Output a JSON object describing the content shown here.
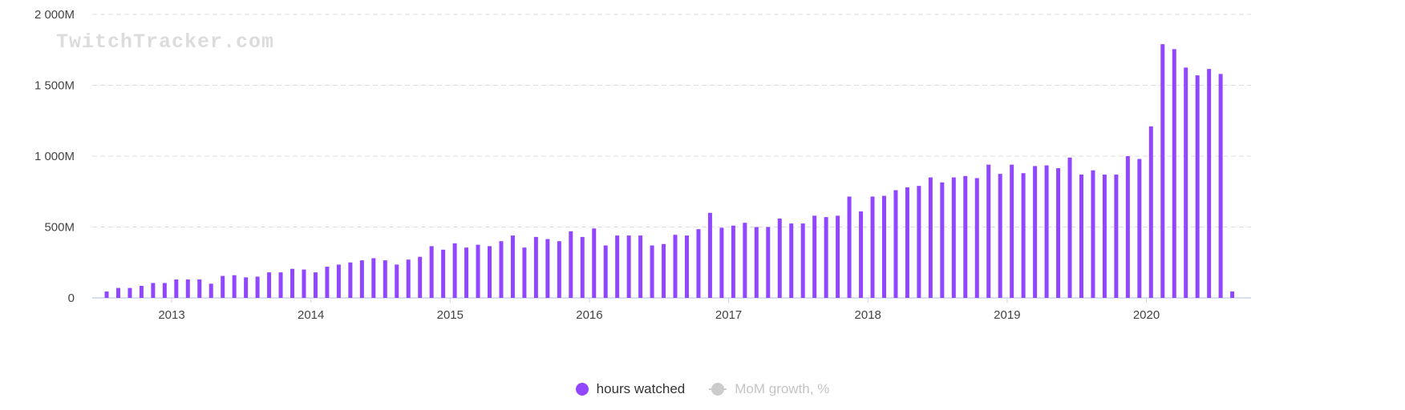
{
  "watermark": "TwitchTracker.com",
  "legend": {
    "hours_watched": "hours watched",
    "mom_growth": "MoM growth, %"
  },
  "colors": {
    "bar": "#9147ff",
    "inactive": "#cccccc"
  },
  "chart_data": {
    "type": "bar",
    "title": "",
    "xlabel": "",
    "ylabel": "",
    "ylim": [
      0,
      2000
    ],
    "y_unit": "M",
    "y_ticks": [
      {
        "value": 0,
        "label": "0"
      },
      {
        "value": 500,
        "label": "500M"
      },
      {
        "value": 1000,
        "label": "1 000M"
      },
      {
        "value": 1500,
        "label": "1 500M"
      },
      {
        "value": 2000,
        "label": "2 000M"
      }
    ],
    "x_ticks": [
      "2013",
      "2014",
      "2015",
      "2016",
      "2017",
      "2018",
      "2019",
      "2020"
    ],
    "grid": true,
    "legend_position": "bottom-center",
    "series": [
      {
        "name": "hours watched",
        "start": "2012-07",
        "values": [
          45,
          70,
          70,
          85,
          105,
          105,
          130,
          130,
          130,
          100,
          155,
          160,
          145,
          150,
          180,
          180,
          205,
          200,
          180,
          220,
          235,
          250,
          265,
          280,
          265,
          235,
          270,
          290,
          365,
          340,
          385,
          355,
          375,
          365,
          400,
          440,
          355,
          430,
          415,
          400,
          470,
          430,
          490,
          370,
          440,
          440,
          440,
          370,
          380,
          445,
          440,
          485,
          600,
          495,
          510,
          530,
          500,
          500,
          560,
          525,
          525,
          580,
          570,
          580,
          715,
          610,
          715,
          720,
          760,
          780,
          790,
          850,
          815,
          850,
          860,
          845,
          940,
          875,
          940,
          880,
          930,
          935,
          915,
          990,
          870,
          900,
          870,
          870,
          1000,
          980,
          1210,
          1790,
          1755,
          1625,
          1570,
          1615,
          1580,
          45
        ]
      }
    ]
  }
}
